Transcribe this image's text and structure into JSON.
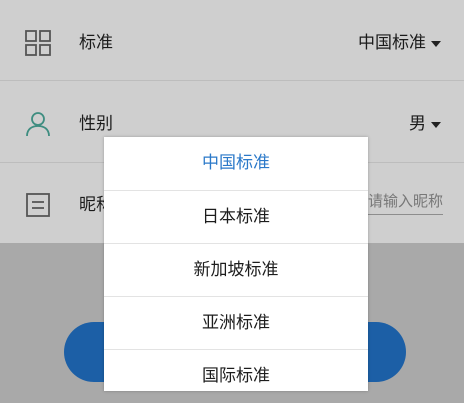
{
  "form": {
    "standard": {
      "label": "标准",
      "value": "中国标准"
    },
    "gender": {
      "label": "性别",
      "value": "男"
    },
    "nickname": {
      "label": "昵称",
      "placeholder": "请输入昵称"
    }
  },
  "dropdown": {
    "options": [
      {
        "label": "中国标准",
        "selected": true
      },
      {
        "label": "日本标准"
      },
      {
        "label": "新加坡标准"
      },
      {
        "label": "亚洲标准"
      },
      {
        "label": "国际标准"
      }
    ]
  },
  "icons": {
    "standard": "grid-icon",
    "gender": "person-icon",
    "nickname": "form-icon"
  },
  "colors": {
    "accent": "#2b79c9",
    "button": "#1c5fa6",
    "person_icon": "#3e8d80"
  }
}
